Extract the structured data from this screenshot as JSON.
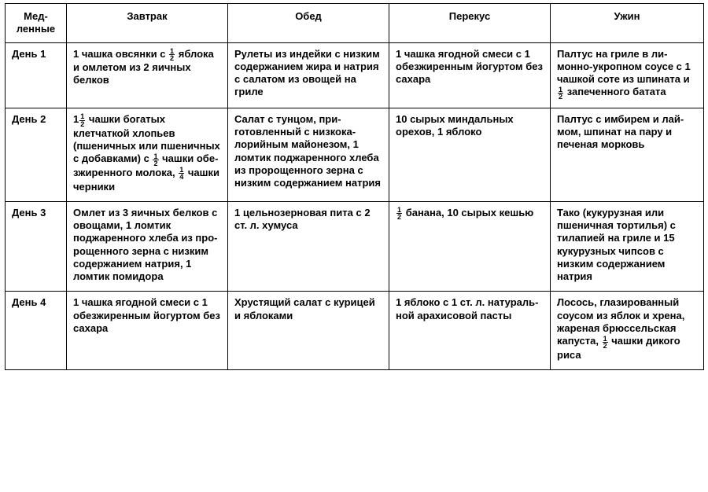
{
  "headers": {
    "h0a": "Мед-",
    "h0b": "ленные",
    "h1": "Завтрак",
    "h2": "Обед",
    "h3": "Перекус",
    "h4": "Ужин"
  },
  "rows": [
    {
      "day": "День 1",
      "breakfast_a": "1 чашка овсянки с",
      "breakfast_b": "яблока и ом­летом из 2 яичных белков",
      "lunch": "Рулеты из индейки с низ­ким содержанием жира и натрия с салатом из овощей на гриле",
      "snack": "1 чашка ягодной смеси с 1 обезжиренным йогур­том без сахара",
      "dinner_a": "Палтус на гриле в ли­монно-укропном соусе с 1 чашкой соте из шпи­ната и",
      "dinner_b": "запеченного батата"
    },
    {
      "day": "День 2",
      "breakfast_a": "чашки богатых клетчаткой хлопьев (пшеничных или пше­ничных с добавками) с",
      "breakfast_b": "чашки обе­зжиренного молока,",
      "breakfast_c": "чашки черники",
      "lunch": "Салат с тунцом, при­готовленный с низкока­лорийным майонезом, 1 ломтик поджаренного хлеба из пророщенного зерна с низким содер­жанием натрия",
      "snack": "10 сырых миндальных орехов, 1 яблоко",
      "dinner": "Палтус с имбирем и лай­мом, шпинат на пару и печеная морковь"
    },
    {
      "day": "День 3",
      "breakfast": "Омлет из 3 яичных белков с овощами, 1 ломтик поджарен­ного хлеба из про­рощенного зерна с низким содержанием натрия, 1 ломтик по­мидора",
      "lunch": "1 цельнозерновая пита с 2 ст. л. хумуса",
      "snack_b": "банана, 10 сырых кешью",
      "dinner": "Тако (кукурузная или пшеничная тортилья) с тилапией на гриле и 15 кукурузных чипсов с низким содержанием натрия"
    },
    {
      "day": "День 4",
      "breakfast": "1 чашка ягодной сме­си с 1 обезжиренным йогуртом без сахара",
      "lunch": "Хрустящий салат с кури­цей и яблоками",
      "snack": "1 яблоко с 1 ст. л. на­тураль­ной арахисовой пасты",
      "dinner_a": "Лосось, глазированный соусом из яблок и хре­на, жареная брюссель­ская капуста,",
      "dinner_b": "чашки дикого риса"
    }
  ],
  "fractions": {
    "half_num": "1",
    "half_den": "2",
    "quarter_num": "1",
    "quarter_den": "4",
    "one": "1"
  }
}
